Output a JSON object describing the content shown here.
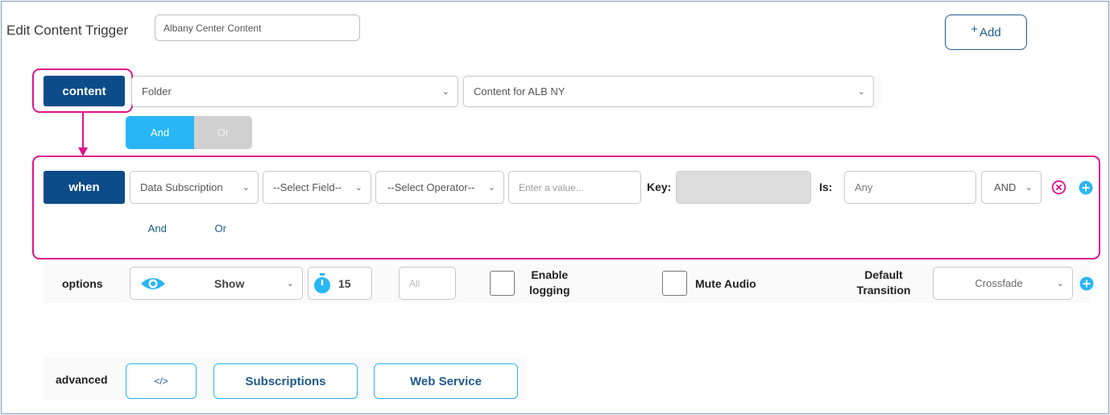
{
  "header": {
    "title": "Edit Content Trigger",
    "trigger_name": "Albany Center Content",
    "add_label": "Add",
    "add_icon": "plus-icon"
  },
  "content_row": {
    "button_label": "content",
    "type_select": "Folder",
    "folder_select": "Content for ALB NY",
    "toggle": {
      "and": "And",
      "or": "Or",
      "selected": "And"
    }
  },
  "when_row": {
    "button_label": "when",
    "source_select": "Data Subscription",
    "field_select": "--Select Field--",
    "operator_select": "--Select Operator--",
    "value_placeholder": "Enter a value...",
    "key_label": "Key:",
    "key_value": "",
    "is_label": "Is:",
    "is_value": "Any",
    "logic_select": "AND",
    "remove_icon": "close-circle-icon",
    "add_icon": "plus-circle-icon",
    "toggle": {
      "and": "And",
      "or": "Or"
    }
  },
  "options_row": {
    "label": "options",
    "visibility_select": "Show",
    "visibility_icon": "eye-icon",
    "timer_icon": "stopwatch-icon",
    "duration": "15",
    "all_placeholder": "All",
    "enable_logging_label_1": "Enable",
    "enable_logging_label_2": "logging",
    "mute_audio_label": "Mute Audio",
    "default_transition_label_1": "Default",
    "default_transition_label_2": "Transition",
    "transition_select": "Crossfade",
    "add_icon": "plus-circle-icon"
  },
  "advanced_row": {
    "label": "advanced",
    "code_button": "</>",
    "subscriptions_button": "Subscriptions",
    "web_service_button": "Web Service"
  },
  "colors": {
    "primary_dark": "#0d4c8a",
    "accent_blue": "#29b6f6",
    "highlight_magenta": "#e0138c"
  }
}
